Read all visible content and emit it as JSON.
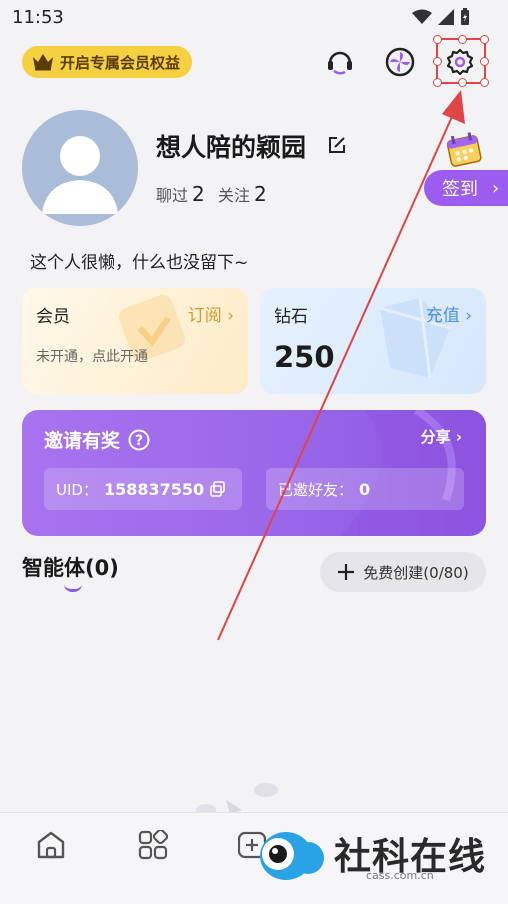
{
  "status_bar": {
    "time": "11:53"
  },
  "header": {
    "vip_banner": "开启专属会员权益",
    "icons": [
      "headset-icon",
      "pinwheel-icon",
      "gear-icon"
    ]
  },
  "profile": {
    "name": "想人陪的颖园",
    "chats_label": "聊过",
    "chats_count": "2",
    "follow_label": "关注",
    "follow_count": "2",
    "bio": "这个人很懒，什么也没留下~",
    "signin_label": "签到"
  },
  "cards": {
    "vip": {
      "title": "会员",
      "action": "订阅",
      "status": "未开通，点此开通"
    },
    "diamond": {
      "title": "钻石",
      "action": "充值",
      "amount": "250"
    }
  },
  "invite": {
    "title": "邀请有奖",
    "share": "分享",
    "uid_label": "UID：",
    "uid": "158837550",
    "invited_label": "已邀好友：",
    "invited_count": "0"
  },
  "agents": {
    "title": "智能体(0)",
    "create_label": "免费创建(0/80)"
  },
  "watermark": {
    "text": "社科在线",
    "url": "cass.com.cn"
  },
  "colors": {
    "accent_purple": "#9d5cf0",
    "vip_gold": "#f5d041",
    "highlight_red": "#e04545"
  }
}
